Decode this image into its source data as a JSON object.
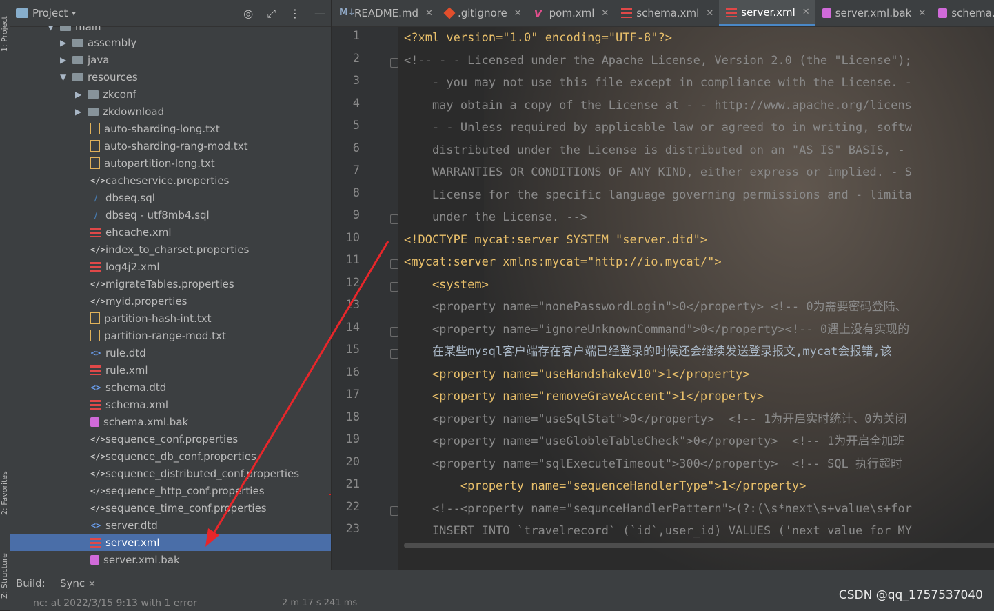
{
  "side_tabs": {
    "project": "1: Project",
    "favorites": "2: Favorites",
    "structure": "Z: Structure"
  },
  "project_panel": {
    "title": "Project",
    "partial_top": "main",
    "items": [
      {
        "label": "assembly",
        "type": "folder",
        "arrow": "▶",
        "indent": 1
      },
      {
        "label": "java",
        "type": "folder",
        "arrow": "▶",
        "indent": 1
      },
      {
        "label": "resources",
        "type": "res",
        "arrow": "▼",
        "indent": 1
      },
      {
        "label": "zkconf",
        "type": "folder",
        "arrow": "▶",
        "indent": 2
      },
      {
        "label": "zkdownload",
        "type": "folder",
        "arrow": "▶",
        "indent": 2
      },
      {
        "label": "auto-sharding-long.txt",
        "type": "txt",
        "indent": 2
      },
      {
        "label": "auto-sharding-rang-mod.txt",
        "type": "txt",
        "indent": 2
      },
      {
        "label": "autopartition-long.txt",
        "type": "txt",
        "indent": 2
      },
      {
        "label": "cacheservice.properties",
        "type": "prop",
        "indent": 2
      },
      {
        "label": "dbseq.sql",
        "type": "sql",
        "indent": 2
      },
      {
        "label": "dbseq - utf8mb4.sql",
        "type": "sql",
        "indent": 2
      },
      {
        "label": "ehcache.xml",
        "type": "xml",
        "indent": 2
      },
      {
        "label": "index_to_charset.properties",
        "type": "prop",
        "indent": 2
      },
      {
        "label": "log4j2.xml",
        "type": "xml",
        "indent": 2
      },
      {
        "label": "migrateTables.properties",
        "type": "prop",
        "indent": 2
      },
      {
        "label": "myid.properties",
        "type": "prop",
        "indent": 2
      },
      {
        "label": "partition-hash-int.txt",
        "type": "txt",
        "indent": 2
      },
      {
        "label": "partition-range-mod.txt",
        "type": "txt",
        "indent": 2
      },
      {
        "label": "rule.dtd",
        "type": "dtd",
        "indent": 2
      },
      {
        "label": "rule.xml",
        "type": "xml",
        "indent": 2
      },
      {
        "label": "schema.dtd",
        "type": "dtd",
        "indent": 2
      },
      {
        "label": "schema.xml",
        "type": "xml",
        "indent": 2
      },
      {
        "label": "schema.xml.bak",
        "type": "bak",
        "indent": 2
      },
      {
        "label": "sequence_conf.properties",
        "type": "prop",
        "indent": 2
      },
      {
        "label": "sequence_db_conf.properties",
        "type": "prop",
        "indent": 2
      },
      {
        "label": "sequence_distributed_conf.properties",
        "type": "prop",
        "indent": 2
      },
      {
        "label": "sequence_http_conf.properties",
        "type": "prop",
        "indent": 2
      },
      {
        "label": "sequence_time_conf.properties",
        "type": "prop",
        "indent": 2
      },
      {
        "label": "server.dtd",
        "type": "dtd",
        "indent": 2
      },
      {
        "label": "server.xml",
        "type": "xml",
        "indent": 2,
        "selected": true
      },
      {
        "label": "server.xml.bak",
        "type": "bak",
        "indent": 2
      }
    ]
  },
  "tabs": [
    {
      "label": "README.md",
      "icon": "md"
    },
    {
      "label": ".gitignore",
      "icon": "git"
    },
    {
      "label": "pom.xml",
      "icon": "pom"
    },
    {
      "label": "schema.xml",
      "icon": "xml"
    },
    {
      "label": "server.xml",
      "icon": "xml",
      "active": true
    },
    {
      "label": "server.xml.bak",
      "icon": "bak"
    },
    {
      "label": "schema.",
      "icon": "bak"
    }
  ],
  "editor": {
    "line_numbers": [
      "1",
      "2",
      "3",
      "4",
      "5",
      "6",
      "7",
      "8",
      "9",
      "10",
      "11",
      "12",
      "13",
      "14",
      "15",
      "16",
      "17",
      "18",
      "19",
      "20",
      "21",
      "22",
      "23"
    ],
    "lines": [
      "<?xml version=\"1.0\" encoding=\"UTF-8\"?>",
      "<!-- - - Licensed under the Apache License, Version 2.0 (the \"License\");",
      "    - you may not use this file except in compliance with the License. -",
      "    may obtain a copy of the License at - - http://www.apache.org/licens",
      "    - - Unless required by applicable law or agreed to in writing, softw",
      "    distributed under the License is distributed on an \"AS IS\" BASIS, -",
      "    WARRANTIES OR CONDITIONS OF ANY KIND, either express or implied. - S",
      "    License for the specific language governing permissions and - limita",
      "    under the License. -->",
      "<!DOCTYPE mycat:server SYSTEM \"server.dtd\">",
      "<mycat:server xmlns:mycat=\"http://io.mycat/\">",
      "    <system>",
      "    <property name=\"nonePasswordLogin\">0</property> <!-- 0为需要密码登陆、",
      "    <property name=\"ignoreUnknownCommand\">0</property><!-- 0遇上没有实现的",
      "    在某些mysql客户端存在客户端已经登录的时候还会继续发送登录报文,mycat会报错,该",
      "    <property name=\"useHandshakeV10\">1</property>",
      "    <property name=\"removeGraveAccent\">1</property>",
      "    <property name=\"useSqlStat\">0</property>  <!-- 1为开启实时统计、0为关闭",
      "    <property name=\"useGlobleTableCheck\">0</property>  <!-- 1为开启全加班",
      "    <property name=\"sqlExecuteTimeout\">300</property>  <!-- SQL 执行超时",
      "        <property name=\"sequenceHandlerType\">1</property>",
      "    <!--<property name=\"sequnceHandlerPattern\">(?:(\\s*next\\s+value\\s+for",
      "    INSERT INTO `travelrecord` (`id`,user_id) VALUES ('next value for MY"
    ]
  },
  "bottom": {
    "build_label": "Build:",
    "sync_tab": "Sync",
    "status": "nc: at 2022/3/15 9:13 with 1 error",
    "duration": "2 m 17 s 241 ms",
    "watermark": "CSDN @qq_1757537040"
  }
}
